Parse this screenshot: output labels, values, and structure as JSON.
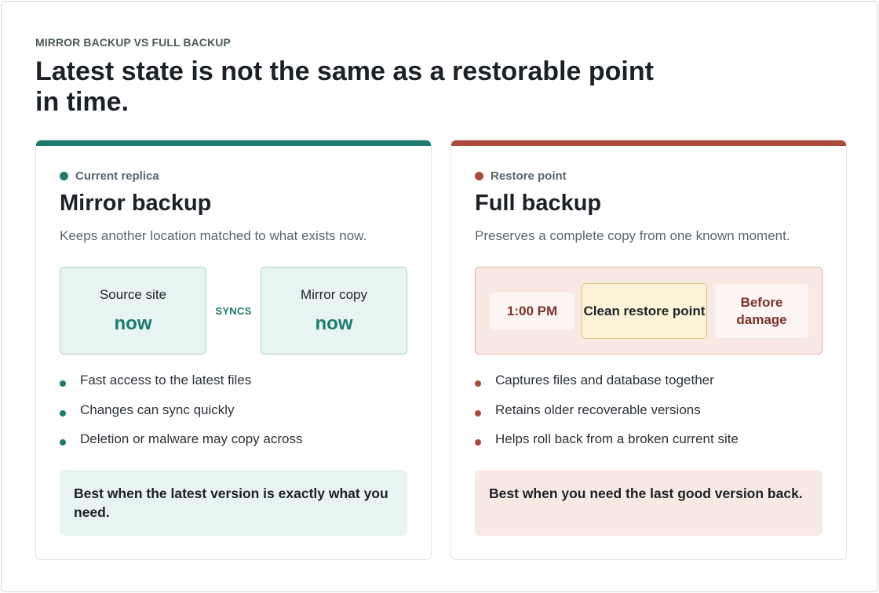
{
  "eyebrow": "MIRROR BACKUP VS FULL BACKUP",
  "headline": "Latest state is not the same as a restorable point in time.",
  "colors": {
    "mirror_accent": "#1c7a6e",
    "full_accent": "#a94a3a"
  },
  "mirror": {
    "tag": "Current replica",
    "title": "Mirror backup",
    "description": "Keeps another location matched to what exists now.",
    "source_label": "Source site",
    "source_value": "now",
    "sync_label": "SYNCS",
    "copy_label": "Mirror copy",
    "copy_value": "now",
    "bullets": [
      "Fast access to the latest files",
      "Changes can sync quickly",
      "Deletion or malware may copy across"
    ],
    "note": "Best when the latest version is exactly what you need."
  },
  "full": {
    "tag": "Restore point",
    "title": "Full backup",
    "description": "Preserves a complete copy from one known moment.",
    "timeline": {
      "time": "1:00 PM",
      "clean": "Clean restore point",
      "before": "Before damage"
    },
    "bullets": [
      "Captures files and database together",
      "Retains older recoverable versions",
      "Helps roll back from a broken current site"
    ],
    "note": "Best when you need the last good version back."
  }
}
